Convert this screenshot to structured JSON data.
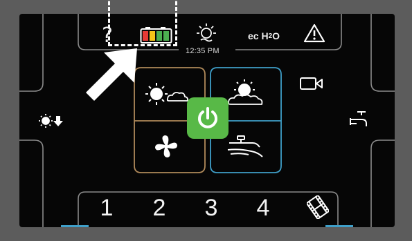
{
  "status_bar": {
    "help_label": "?",
    "time": "12:35 PM",
    "ech2o_main": "ec H",
    "ech2o_sub": "2",
    "ech2o_tail": "O"
  },
  "presets": [
    "1",
    "2",
    "3",
    "4"
  ],
  "icons": {
    "help": "question-icon",
    "battery": "battery-icon",
    "light": "light-bulb-icon",
    "warning": "warning-icon",
    "camera": "video-camera-icon",
    "faucet": "faucet-icon",
    "light_down": "light-down-icon",
    "power": "power-icon",
    "fan": "fan-icon",
    "film": "film-icon"
  },
  "colors": {
    "power_button": "#58b947",
    "left_quadrant_outline": "#b08a5a",
    "right_quadrant_outline": "#3f9fc9",
    "battery_cells": [
      "#e53935",
      "#f5c518",
      "#4caf50",
      "#4caf50"
    ]
  }
}
